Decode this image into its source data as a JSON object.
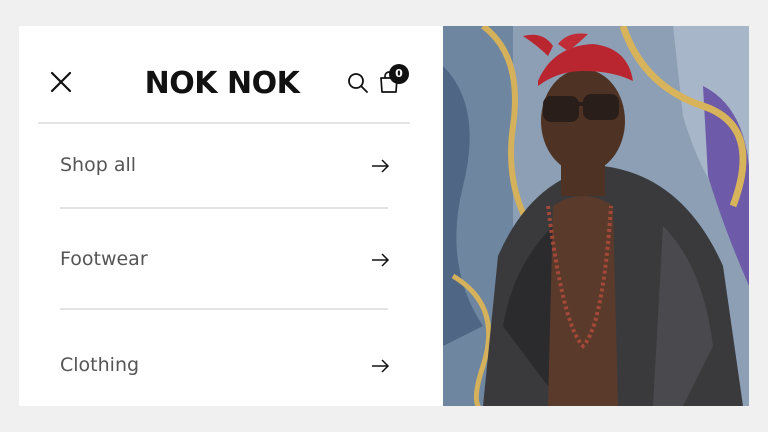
{
  "header": {
    "brand": "NOK NOK",
    "cart_count": "0"
  },
  "menu": {
    "items": [
      {
        "label": "Shop all"
      },
      {
        "label": "Footwear"
      },
      {
        "label": "Clothing"
      }
    ]
  },
  "icons": {
    "close": "close-icon",
    "search": "search-icon",
    "cart": "shopping-bag-icon",
    "arrow": "arrow-right-icon"
  },
  "colors": {
    "background": "#f0f0f0",
    "panel": "#ffffff",
    "text": "#555555",
    "brand": "#111111",
    "divider": "#e3e3e3"
  }
}
